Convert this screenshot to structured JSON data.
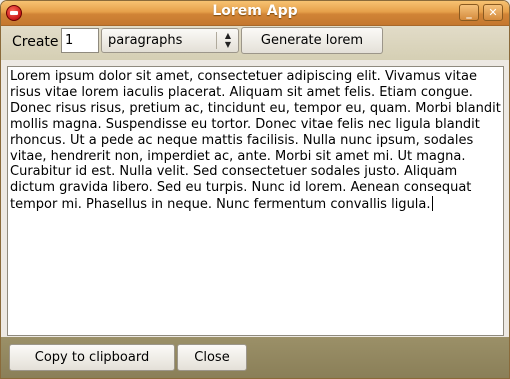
{
  "window": {
    "title": "Lorem App",
    "minimize_glyph": "_",
    "close_glyph": "✕"
  },
  "toolbar": {
    "create_label": "Create",
    "count_value": "1",
    "unit_selected": "paragraphs",
    "generate_label": "Generate lorem"
  },
  "content": {
    "text": "Lorem ipsum dolor sit amet, consectetuer adipiscing elit. Vivamus vitae risus vitae lorem iaculis placerat. Aliquam sit amet felis. Etiam congue. Donec risus risus, pretium ac, tincidunt eu, tempor eu, quam. Morbi blandit mollis magna. Suspendisse eu tortor. Donec vitae felis nec ligula blandit rhoncus. Ut a pede ac neque mattis facilisis. Nulla nunc ipsum, sodales vitae, hendrerit non, imperdiet ac, ante. Morbi sit amet mi. Ut magna. Curabitur id est. Nulla velit. Sed consectetuer sodales justo. Aliquam dictum gravida libero. Sed eu turpis. Nunc id lorem. Aenean consequat tempor mi. Phasellus in neque. Nunc fermentum convallis ligula."
  },
  "footer": {
    "copy_label": "Copy to clipboard",
    "close_label": "Close"
  },
  "colors": {
    "titlebar": "#e6a04a",
    "toolbar": "#d8d2b8",
    "footer": "#928760"
  },
  "icons": {
    "app": "app-logo-icon",
    "minimize": "minimize-icon",
    "close": "close-icon",
    "select_arrows": "updown-arrows-icon"
  }
}
